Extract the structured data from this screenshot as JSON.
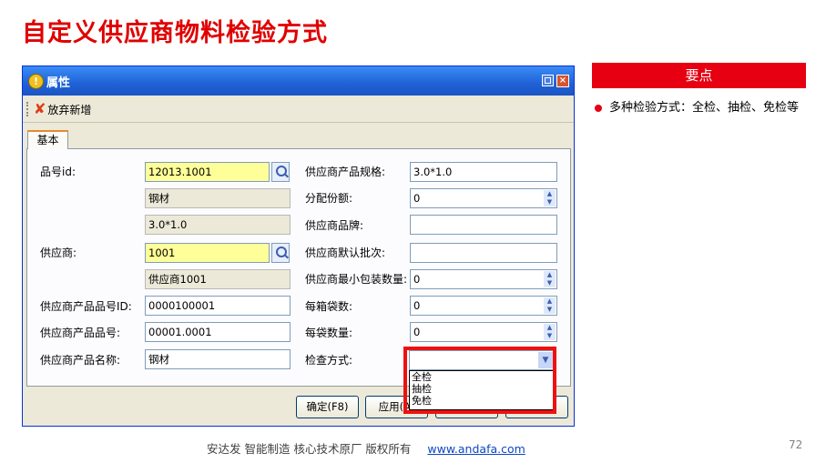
{
  "slide": {
    "title": "自定义供应商物料检验方式",
    "page_number": "72"
  },
  "dialog": {
    "title": "属性",
    "toolbar_abandon": "放弃新增",
    "tab_basic": "基本",
    "fields": {
      "part_no_label": "品号id:",
      "part_no_value": "12013.1001",
      "part_name_value": "钢材",
      "part_spec_value": "3.0*1.0",
      "supplier_label": "供应商:",
      "supplier_value": "1001",
      "supplier_name_value": "供应商1001",
      "sup_part_id_label": "供应商产品品号ID:",
      "sup_part_id_value": "0000100001",
      "sup_part_no_label": "供应商产品品号:",
      "sup_part_no_value": "00001.0001",
      "sup_part_name_label": "供应商产品名称:",
      "sup_part_name_value": "钢材",
      "sup_spec_label": "供应商产品规格:",
      "sup_spec_value": "3.0*1.0",
      "alloc_label": "分配份额:",
      "alloc_value": "0",
      "brand_label": "供应商品牌:",
      "brand_value": "",
      "default_batch_label": "供应商默认批次:",
      "default_batch_value": "",
      "min_pack_label": "供应商最小包装数量:",
      "min_pack_value": "0",
      "per_box_label": "每箱袋数:",
      "per_box_value": "0",
      "per_bag_label": "每袋数量:",
      "per_bag_value": "0",
      "inspect_label": "检查方式:",
      "inspect_value": ""
    },
    "inspect_options": [
      "全检",
      "抽检",
      "免检"
    ],
    "buttons": {
      "ok": "确定(F8)",
      "apply": "应用(A)"
    }
  },
  "keypoints": {
    "header": "要点",
    "bullets": [
      "多种检验方式：全检、抽检、免检等"
    ]
  },
  "footer": {
    "text": "安达发  智能制造 核心技术原厂  版权所有",
    "link": "www.andafa.com"
  }
}
